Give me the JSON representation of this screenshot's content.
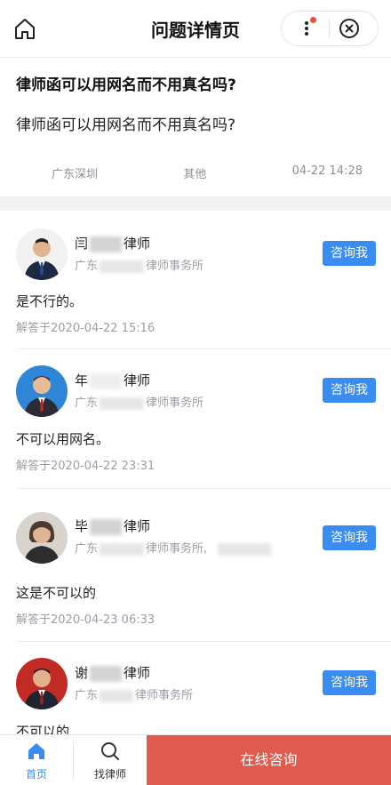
{
  "header": {
    "title": "问题详情页"
  },
  "question": {
    "title": "律师函可以用网名而不用真名吗?",
    "body": "律师函可以用网名而不用真名吗?",
    "location": "广东深圳",
    "category": "其他",
    "time": "04-22 14:28"
  },
  "answers": [
    {
      "name_prefix": "闫",
      "name_suffix": "律师",
      "firm_prefix": "广东",
      "firm_suffix": "律师事务所",
      "consult_label": "咨询我",
      "text": "是不行的。",
      "time": "解答于2020-04-22 15:16"
    },
    {
      "name_prefix": "年",
      "name_suffix": "律师",
      "firm_prefix": "广东",
      "firm_suffix": "律师事务所",
      "consult_label": "咨询我",
      "text": "不可以用网名。",
      "time": "解答于2020-04-22 23:31"
    },
    {
      "name_prefix": "毕",
      "name_suffix": "律师",
      "firm_prefix": "广东",
      "firm_suffix": "律师事务所,",
      "consult_label": "咨询我",
      "text": "这是不可以的",
      "time": "解答于2020-04-23 06:33"
    },
    {
      "name_prefix": "谢",
      "name_suffix": "律师",
      "firm_prefix": "广东",
      "firm_suffix": "律师事务所",
      "consult_label": "咨询我",
      "text": "不可以的",
      "time": ""
    }
  ],
  "tabbar": {
    "home_label": "首页",
    "find_lawyer_label": "找律师",
    "online_consult_label": "在线咨询",
    "active_color": "#3a8cf0",
    "cta_color": "#de5b4d"
  }
}
